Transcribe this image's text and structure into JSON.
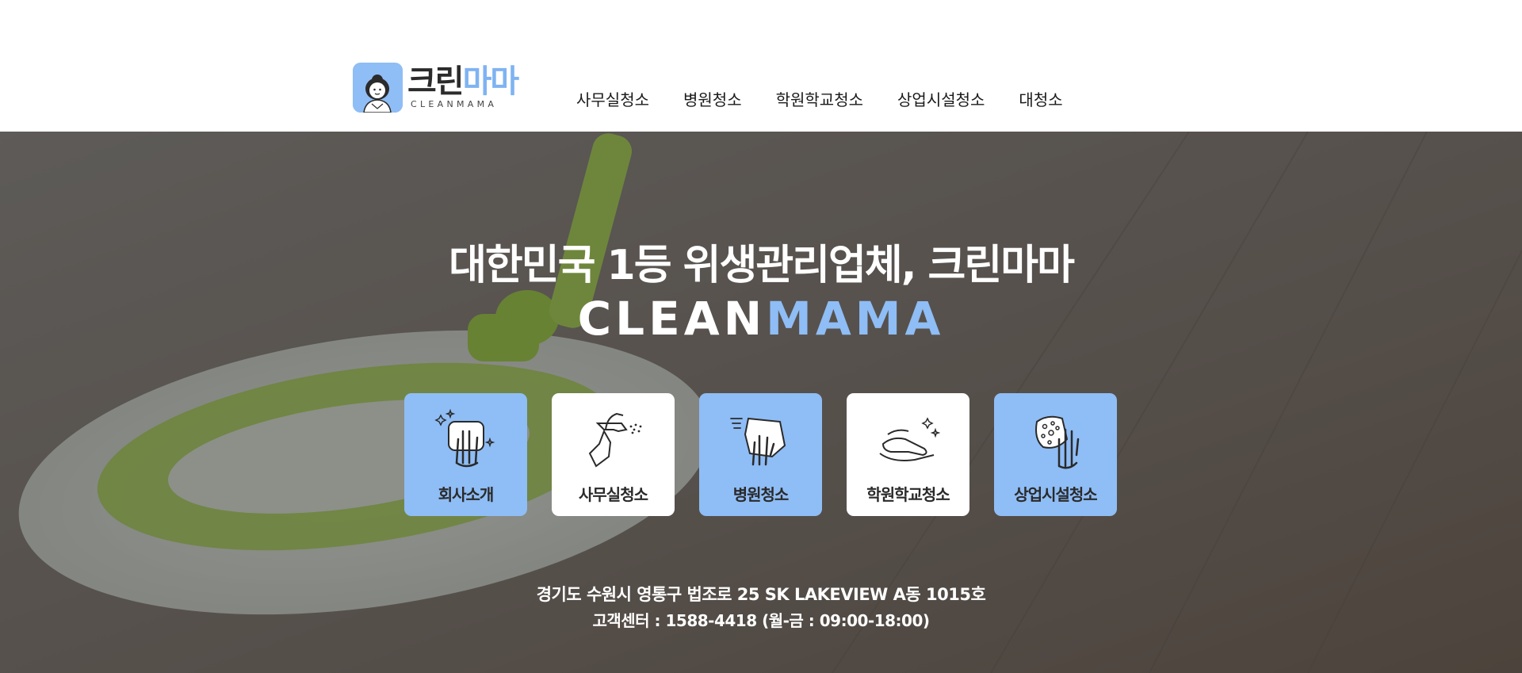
{
  "header": {
    "logo": {
      "text_dark": "크린",
      "text_blue": "마마",
      "subtext": "CLEANMAMA",
      "icon": "cleanmama-mascot-icon"
    },
    "nav": [
      {
        "label": "사무실청소"
      },
      {
        "label": "병원청소"
      },
      {
        "label": "학원학교청소"
      },
      {
        "label": "상업시설청소"
      },
      {
        "label": "대청소"
      }
    ]
  },
  "hero": {
    "headline": "대한민국 1등 위생관리업체, 크린마마",
    "brand_white": "CLEAN",
    "brand_blue": "MAMA",
    "tiles": [
      {
        "label": "회사소개",
        "icon": "sparkling-hand-icon",
        "style": "blue"
      },
      {
        "label": "사무실청소",
        "icon": "spray-bottle-icon",
        "style": "white"
      },
      {
        "label": "병원청소",
        "icon": "wiping-cloth-icon",
        "style": "blue"
      },
      {
        "label": "학원학교청소",
        "icon": "hand-wiping-surface-icon",
        "style": "white"
      },
      {
        "label": "상업시설청소",
        "icon": "sponge-hand-icon",
        "style": "blue"
      }
    ],
    "address": "경기도 수원시 영통구 법조로 25 SK LAKEVIEW A동 1015호",
    "service_center": "고객센터 : 1588-4418 (월-금 : 09:00-18:00)"
  },
  "colors": {
    "accent_blue": "#8fbdf5",
    "overlay": "#3a3a3a",
    "text_dark": "#2a2a2a"
  }
}
